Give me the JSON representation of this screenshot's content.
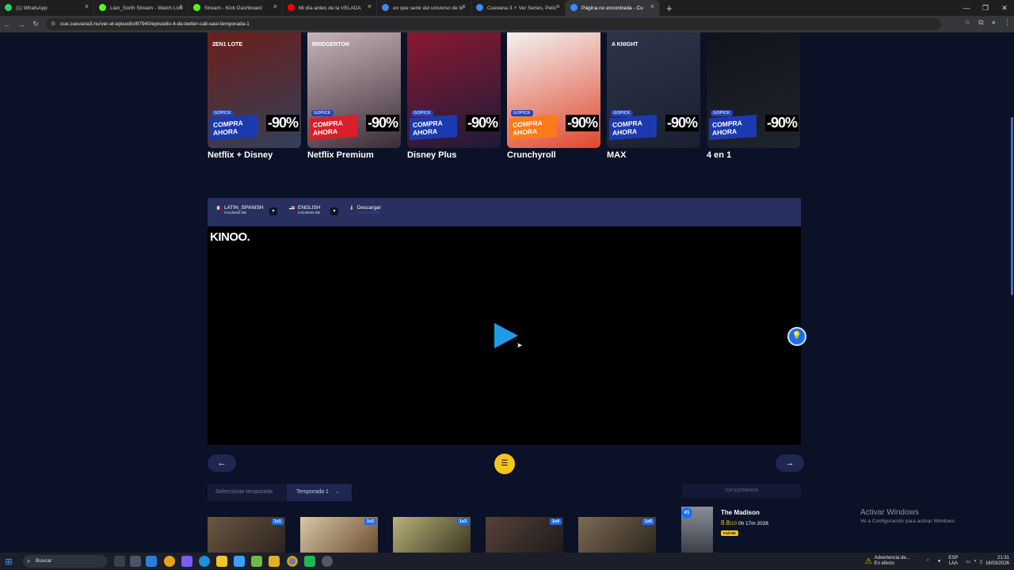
{
  "browser": {
    "tabs": [
      {
        "title": "(1) WhatsApp",
        "favicon_color": "#25d366"
      },
      {
        "title": "Lian_Sorth Stream - Watch Live",
        "favicon_color": "#53fc18"
      },
      {
        "title": "Stream - Kick Dashboard",
        "favicon_color": "#53fc18"
      },
      {
        "title": "Mi día antes de la VELADA",
        "favicon_color": "#ff0000"
      },
      {
        "title": "en que serie del universo de br",
        "favicon_color": "#4285f4"
      },
      {
        "title": "Cuevana 3 ⚡ Ver Series, Pelíc",
        "favicon_color": "#3a8bff"
      },
      {
        "title": "Página no encontrada - Cu",
        "favicon_color": "#3a8bff"
      }
    ],
    "url": "cue.cuevana3.nu/ver-el-episodio/87940/episodio-4-de-better-call-saul-temporada-1"
  },
  "promos": [
    {
      "name": "Netflix + Disney",
      "tagline": "2EN1 LOTE",
      "gradient": [
        "#6b1f1a",
        "#33405a"
      ],
      "label_bg": "#1c3ab0"
    },
    {
      "name": "Netflix Premium",
      "tagline": "BRIDGERTON",
      "gradient": [
        "#c7b4b8",
        "#3b2c38"
      ],
      "label_bg": "#d81f2a"
    },
    {
      "name": "Disney Plus",
      "tagline": "",
      "gradient": [
        "#8a1930",
        "#1d1a3a"
      ],
      "label_bg": "#1c3ab0"
    },
    {
      "name": "Crunchyroll",
      "tagline": "",
      "gradient": [
        "#f2f2f2",
        "#e0472c"
      ],
      "label_bg": "#ff7a1a"
    },
    {
      "name": "MAX",
      "tagline": "A KNIGHT",
      "gradient": [
        "#2c3547",
        "#1a2030"
      ],
      "label_bg": "#1c3ab0"
    },
    {
      "name": "4 en 1",
      "tagline": "",
      "gradient": [
        "#11131c",
        "#20242c"
      ],
      "label_bg": "#1c3ab0"
    }
  ],
  "promo_common": {
    "gopick": "GOPICK",
    "compra": "COMPRA AHORA",
    "discount": "-90%"
  },
  "player": {
    "languages": [
      {
        "name": "LATIN_SPANISH",
        "quality": "CALIDAD HD"
      },
      {
        "name": "ENGLISH",
        "quality": "CALIDAD HD"
      }
    ],
    "download": {
      "label": "Descargar",
      "quality": "CALIDAD HD"
    },
    "logo": "KINOO."
  },
  "season": {
    "label": "Seleccionar temporada",
    "selected": "Temporada 1"
  },
  "episodes": [
    {
      "badge": "1x1",
      "gradient": [
        "#6b5740",
        "#2b2420"
      ]
    },
    {
      "badge": "1x2",
      "gradient": [
        "#d8c7a6",
        "#6b4e30"
      ]
    },
    {
      "badge": "1x3",
      "gradient": [
        "#b9b27a",
        "#3b3620"
      ]
    },
    {
      "badge": "1x4",
      "gradient": [
        "#574238",
        "#1e1a1a"
      ]
    },
    {
      "badge": "1x5",
      "gradient": [
        "#7c6a55",
        "#2d261e"
      ]
    }
  ],
  "top_estrenos": {
    "header": "TOP ESTRENOS",
    "item": {
      "rank": "#1",
      "title": "The Madison",
      "score": "8.8",
      "score_suffix": "/10",
      "duration": "0h 17m",
      "year": "2026",
      "quality": "Full HD"
    }
  },
  "windows_watermark": {
    "title": "Activar Windows",
    "subtitle": "Ve a Configuración para activar Windows."
  },
  "taskbar": {
    "search_placeholder": "Buscar",
    "warning": "Advertencia de...",
    "warning_sub": "En efecto",
    "lang": "ESP",
    "lang_sub": "LAA",
    "time": "21:31",
    "date": "16/03/2026"
  }
}
